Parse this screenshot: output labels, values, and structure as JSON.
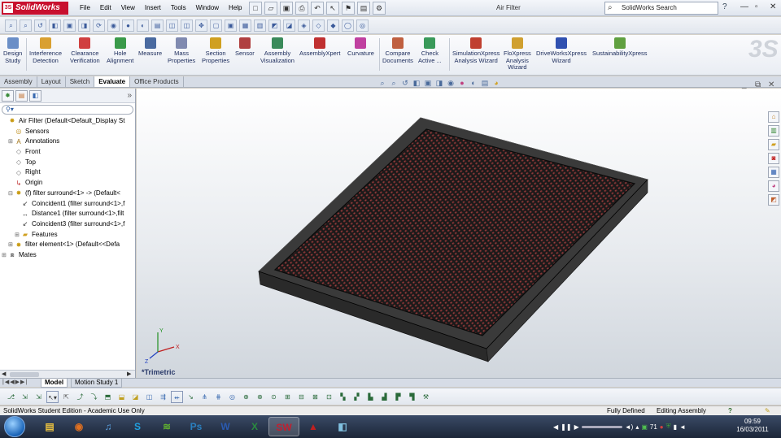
{
  "app": {
    "logo_text": "SolidWorks",
    "document_title": "Air Filter",
    "search_placeholder": "SolidWorks Search"
  },
  "menu": [
    "File",
    "Edit",
    "View",
    "Insert",
    "Tools",
    "Window",
    "Help"
  ],
  "command_manager": [
    {
      "label": "Design\nStudy",
      "color": "#6b8fc7"
    },
    {
      "label": "Interference\nDetection",
      "color": "#d9a030"
    },
    {
      "label": "Clearance\nVerification",
      "color": "#d04040"
    },
    {
      "label": "Hole\nAlignment",
      "color": "#3a9a4a"
    },
    {
      "label": "Measure",
      "color": "#4a6aa0"
    },
    {
      "label": "Mass\nProperties",
      "color": "#808ab0"
    },
    {
      "label": "Section\nProperties",
      "color": "#d0a020"
    },
    {
      "label": "Sensor",
      "color": "#b04040"
    },
    {
      "label": "Assembly\nVisualization",
      "color": "#3a8a5a"
    },
    {
      "label": "AssemblyXpert",
      "color": "#c03030"
    },
    {
      "label": "Curvature",
      "color": "#c040a0"
    },
    {
      "label": "Compare\nDocuments",
      "color": "#c06040"
    },
    {
      "label": "Check\nActive ...",
      "color": "#3a9a5a"
    },
    {
      "label": "SimulationXpress\nAnalysis Wizard",
      "color": "#c04030"
    },
    {
      "label": "FloXpress\nAnalysis\nWizard",
      "color": "#d0a030"
    },
    {
      "label": "DriveWorksXpress\nWizard",
      "color": "#3050b0"
    },
    {
      "label": "SustainabilityXpress",
      "color": "#60a040"
    }
  ],
  "tabs": [
    "Assembly",
    "Layout",
    "Sketch",
    "Evaluate",
    "Office Products"
  ],
  "active_tab": "Evaluate",
  "tree": [
    {
      "label": "Air Filter  (Default<Default_Display St",
      "indent": 0,
      "exp": "",
      "icon": "assembly-icon",
      "glyph": "✸",
      "color": "#c89a10"
    },
    {
      "label": "Sensors",
      "indent": 1,
      "exp": "",
      "icon": "sensors-icon",
      "glyph": "◎",
      "color": "#c09020"
    },
    {
      "label": "Annotations",
      "indent": 1,
      "exp": "+",
      "icon": "annotations-icon",
      "glyph": "A",
      "color": "#a07010"
    },
    {
      "label": "Front",
      "indent": 1,
      "exp": "",
      "icon": "plane-icon",
      "glyph": "◇",
      "color": "#777"
    },
    {
      "label": "Top",
      "indent": 1,
      "exp": "",
      "icon": "plane-icon",
      "glyph": "◇",
      "color": "#777"
    },
    {
      "label": "Right",
      "indent": 1,
      "exp": "",
      "icon": "plane-icon",
      "glyph": "◇",
      "color": "#777"
    },
    {
      "label": "Origin",
      "indent": 1,
      "exp": "",
      "icon": "origin-icon",
      "glyph": "↳",
      "color": "#c03030"
    },
    {
      "label": "(f) filter surround<1> -> (Default<",
      "indent": 1,
      "exp": "-",
      "icon": "part-icon",
      "glyph": "✸",
      "color": "#c89a10"
    },
    {
      "label": "Coincident1 (filter surround<1>,f",
      "indent": 2,
      "exp": "",
      "icon": "mate-coincident-icon",
      "glyph": "↙",
      "color": "#333"
    },
    {
      "label": "Distance1 (filter surround<1>,filt",
      "indent": 2,
      "exp": "",
      "icon": "mate-distance-icon",
      "glyph": "↔",
      "color": "#333"
    },
    {
      "label": "Coincident3 (filter surround<1>,f",
      "indent": 2,
      "exp": "",
      "icon": "mate-coincident-icon",
      "glyph": "↙",
      "color": "#333"
    },
    {
      "label": "Features",
      "indent": 2,
      "exp": "+",
      "icon": "features-folder-icon",
      "glyph": "▰",
      "color": "#d0a020"
    },
    {
      "label": "filter element<1> (Default<<Defa",
      "indent": 1,
      "exp": "+",
      "icon": "part-icon",
      "glyph": "✸",
      "color": "#c89a10"
    },
    {
      "label": "Mates",
      "indent": 0,
      "exp": "+",
      "icon": "mates-icon",
      "glyph": "⧈",
      "color": "#333"
    }
  ],
  "viewport": {
    "view_name": "*Trimetric"
  },
  "bottom_tabs": [
    "Model",
    "Motion Study 1"
  ],
  "active_bottom_tab": "Model",
  "status": {
    "edition": "SolidWorks Student Edition - Academic Use Only",
    "definition": "Fully Defined",
    "mode": "Editing Assembly"
  },
  "taskbar": {
    "apps": [
      {
        "name": "explorer",
        "glyph": "▤",
        "color": "#e8c040"
      },
      {
        "name": "firefox",
        "glyph": "◉",
        "color": "#e07020"
      },
      {
        "name": "itunes",
        "glyph": "♫",
        "color": "#5aa0e0"
      },
      {
        "name": "skype",
        "glyph": "S",
        "color": "#20a0e0"
      },
      {
        "name": "spotify",
        "glyph": "≋",
        "color": "#60b030"
      },
      {
        "name": "photoshop",
        "glyph": "Ps",
        "color": "#2a80c0"
      },
      {
        "name": "word",
        "glyph": "W",
        "color": "#2a5ab0"
      },
      {
        "name": "excel",
        "glyph": "X",
        "color": "#2a8a40"
      },
      {
        "name": "solidworks",
        "glyph": "SW",
        "color": "#c02030"
      },
      {
        "name": "acrobat",
        "glyph": "▲",
        "color": "#c02020"
      },
      {
        "name": "other",
        "glyph": "◧",
        "color": "#80c0e0"
      }
    ],
    "tray_text": "71",
    "time": "09:59",
    "date": "16/03/2011"
  }
}
